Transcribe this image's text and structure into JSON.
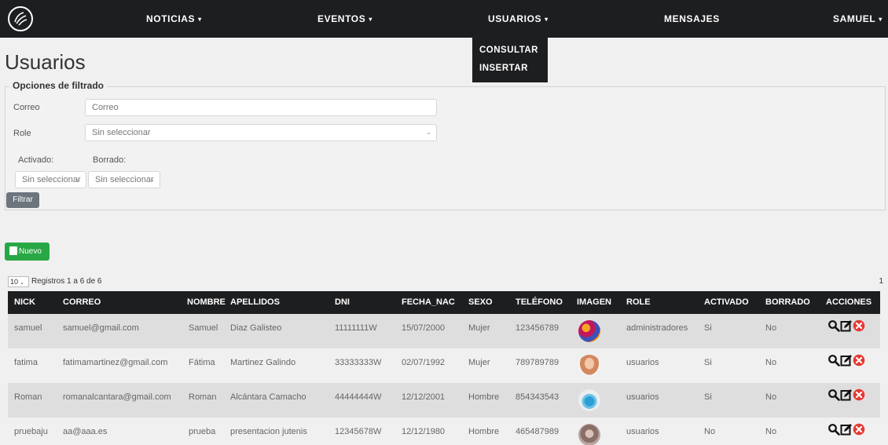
{
  "nav": {
    "items": [
      "NOTICIAS",
      "EVENTOS",
      "USUARIOS",
      "MENSAJES",
      "SAMUEL"
    ],
    "caret": "▾",
    "dropdown": [
      "CONSULTAR",
      "INSERTAR"
    ]
  },
  "page_title": "Usuarios",
  "filter": {
    "legend": "Opciones de filtrado",
    "correo_label": "Correo",
    "correo_placeholder": "Correo",
    "role_label": "Role",
    "role_value": "Sin seleccionar",
    "activado_label": "Activado:",
    "activado_value": "Sin seleccionar",
    "borrado_label": "Borrado:",
    "borrado_value": "Sin seleccionar",
    "button": "Filtrar"
  },
  "nuevo_button": "Nuevo",
  "records": {
    "per_page": "10",
    "text": "Registros 1 a 6 de 6",
    "page": "1"
  },
  "table": {
    "headers": [
      "NICK",
      "CORREO",
      "NOMBRE",
      "APELLIDOS",
      "DNI",
      "FECHA_NAC",
      "SEXO",
      "TELÉFONO",
      "IMAGEN",
      "ROLE",
      "ACTIVADO",
      "BORRADO",
      "ACCIONES"
    ],
    "rows": [
      {
        "nick": "samuel",
        "correo": "samuel@gmail.com",
        "nombre": "Samuel",
        "apellidos": "Diaz Galisteo",
        "dni": "11111111W",
        "fecha": "15/07/2000",
        "sexo": "Mujer",
        "telefono": "123456789",
        "role": "administradores",
        "activado": "Si",
        "borrado": "No"
      },
      {
        "nick": "fatima",
        "correo": "fatimamartinez@gmail.com",
        "nombre": "Fátima",
        "apellidos": "Martinez Galindo",
        "dni": "33333333W",
        "fecha": "02/07/1992",
        "sexo": "Mujer",
        "telefono": "789789789",
        "role": "usuarios",
        "activado": "Si",
        "borrado": "No"
      },
      {
        "nick": "Roman",
        "correo": "romanalcantara@gmail.com",
        "nombre": "Roman",
        "apellidos": "Alcántara Camacho",
        "dni": "44444444W",
        "fecha": "12/12/2001",
        "sexo": "Hombre",
        "telefono": "854343543",
        "role": "usuarios",
        "activado": "Si",
        "borrado": "No"
      },
      {
        "nick": "pruebaju",
        "correo": "aa@aaa.es",
        "nombre": "prueba",
        "apellidos": "presentacion jutenis",
        "dni": "12345678W",
        "fecha": "12/12/1980",
        "sexo": "Hombre",
        "telefono": "465487989",
        "role": "usuarios",
        "activado": "No",
        "borrado": "No"
      }
    ]
  },
  "colors": {
    "nav_bg": "#1d1e20",
    "nuevo_green": "#28a745",
    "filtrar_gray": "#6c757d",
    "delete_red": "#e53935"
  },
  "icons": [
    "logo-icon",
    "chevron-down-icon",
    "add-user-icon",
    "search-icon",
    "edit-icon",
    "delete-icon",
    "avatar-image"
  ]
}
